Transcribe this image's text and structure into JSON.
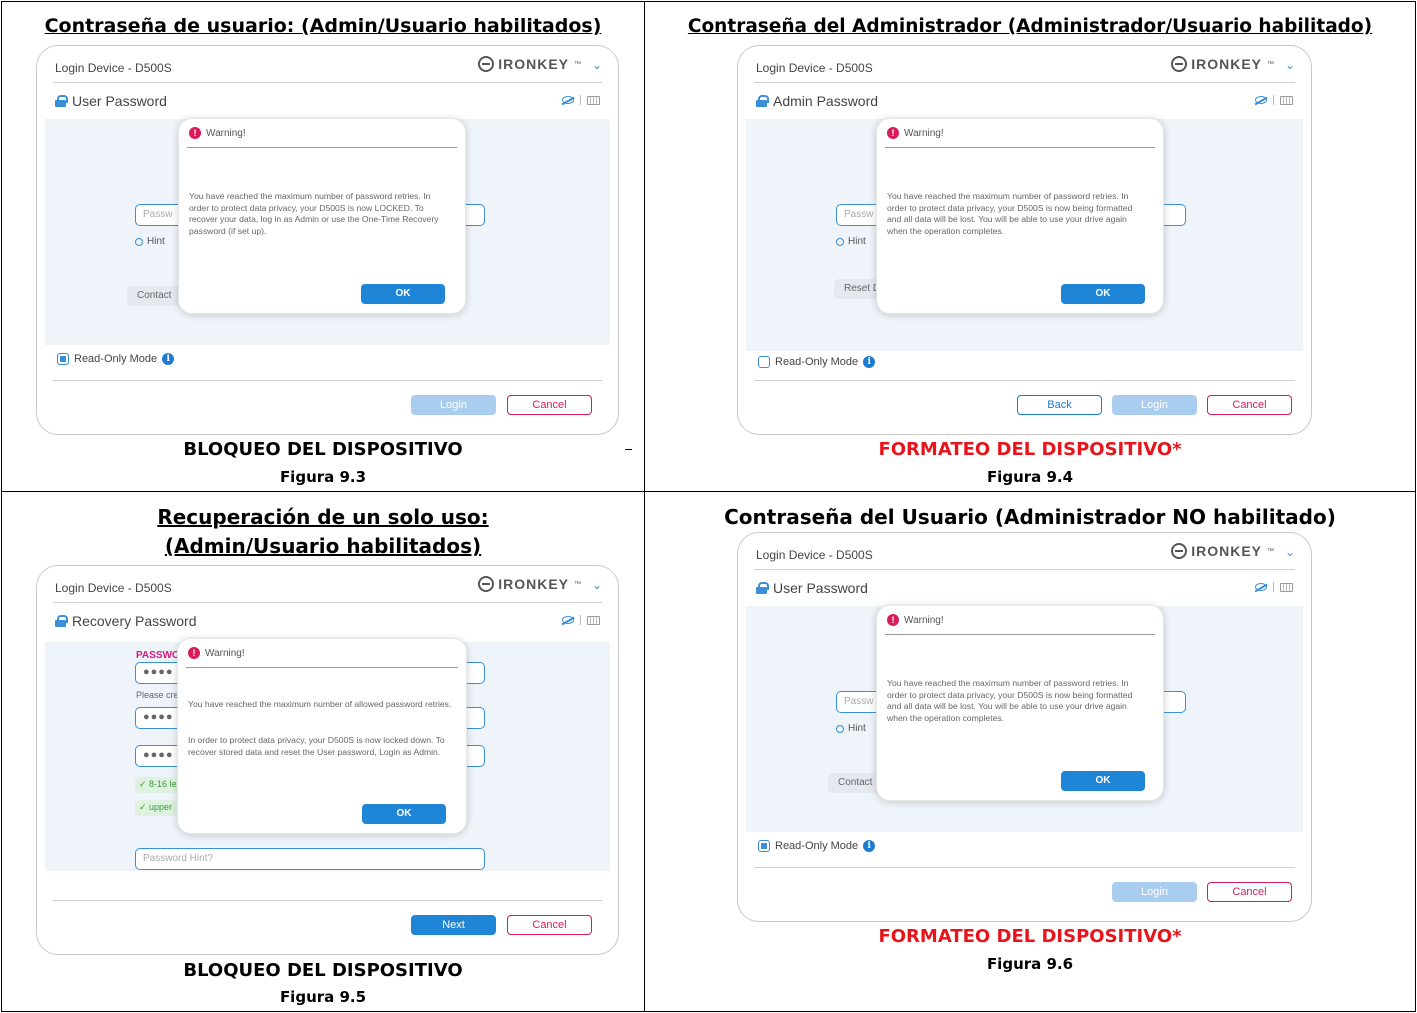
{
  "cells": {
    "c1": {
      "title": "Contraseña de usuario: (Admin/Usuario habilitados)",
      "caption": "BLOQUEO DEL DISPOSITIVO",
      "figure": "Figura 9.3",
      "shot": {
        "window_title": "Login Device - D500S",
        "brand": "IRONKEY",
        "header": "User Password",
        "field_placeholder": "Passw",
        "hint": "Hint",
        "contact": "Contact",
        "read_only": "Read-Only Mode",
        "read_only_checked": true,
        "login": "Login",
        "cancel": "Cancel",
        "dialog": {
          "warning": "Warning!",
          "message": "You have reached the maximum number of password retries. In order to protect data privacy, your D500S is now LOCKED. To recover your data, log in as Admin or use the One-Time Recovery password (if set up).",
          "ok": "OK"
        }
      }
    },
    "c2": {
      "title": "Contraseña del Administrador (Administrador/Usuario habilitado)",
      "caption": "FORMATEO DEL DISPOSITIVO*",
      "figure": "Figura 9.4",
      "shot": {
        "window_title": "Login Device - D500S",
        "brand": "IRONKEY",
        "header": "Admin Password",
        "field_placeholder": "Passw",
        "hint": "Hint",
        "reset": "Reset D",
        "read_only": "Read-Only Mode",
        "read_only_checked": false,
        "back": "Back",
        "login": "Login",
        "cancel": "Cancel",
        "dialog": {
          "warning": "Warning!",
          "message": "You have reached the maximum number of password retries. In order to protect data privacy, your D500S is now being formatted and all data will be lost. You will be able to use your drive again when the operation completes.",
          "ok": "OK"
        }
      }
    },
    "c3": {
      "title_line1": "Recuperación de un solo uso:",
      "title_line2": "(Admin/Usuario habilitados)",
      "caption": "BLOQUEO DEL DISPOSITIVO",
      "figure": "Figura 9.5",
      "shot": {
        "window_title": "Login Device - D500S",
        "brand": "IRONKEY",
        "header": "Recovery Password",
        "password_label": "PASSWO",
        "dots": "●●●●",
        "please": "Please cre",
        "rule1": "✓ 8-16 le",
        "rule2": "✓ upper",
        "hint_placeholder": "Password Hint?",
        "next": "Next",
        "cancel": "Cancel",
        "dialog": {
          "warning": "Warning!",
          "message_p1": "You have reached the maximum number of allowed password retries.",
          "message_p2": "In order to protect data privacy, your D500S is now locked down. To recover stored data and reset the User password, Login as Admin.",
          "ok": "OK"
        }
      }
    },
    "c4": {
      "title": "Contraseña del Usuario (Administrador NO habilitado)",
      "caption": "FORMATEO DEL DISPOSITIVO*",
      "figure": "Figura 9.6",
      "shot": {
        "window_title": "Login Device - D500S",
        "brand": "IRONKEY",
        "header": "User Password",
        "field_placeholder": "Passw",
        "hint": "Hint",
        "contact": "Contact",
        "read_only": "Read-Only Mode",
        "read_only_checked": true,
        "login": "Login",
        "cancel": "Cancel",
        "dialog": {
          "warning": "Warning!",
          "message": "You have reached the maximum number of password retries. In order to protect data privacy, your D500S is now being formatted and all data will be lost. You will be able to use your drive again when the operation completes.",
          "ok": "OK"
        }
      }
    }
  },
  "colors": {
    "caption_red": "#e8141c",
    "accent_blue": "#1f85d6",
    "warning_pink": "#d81b5a",
    "panel_bg": "#eef4fa"
  }
}
